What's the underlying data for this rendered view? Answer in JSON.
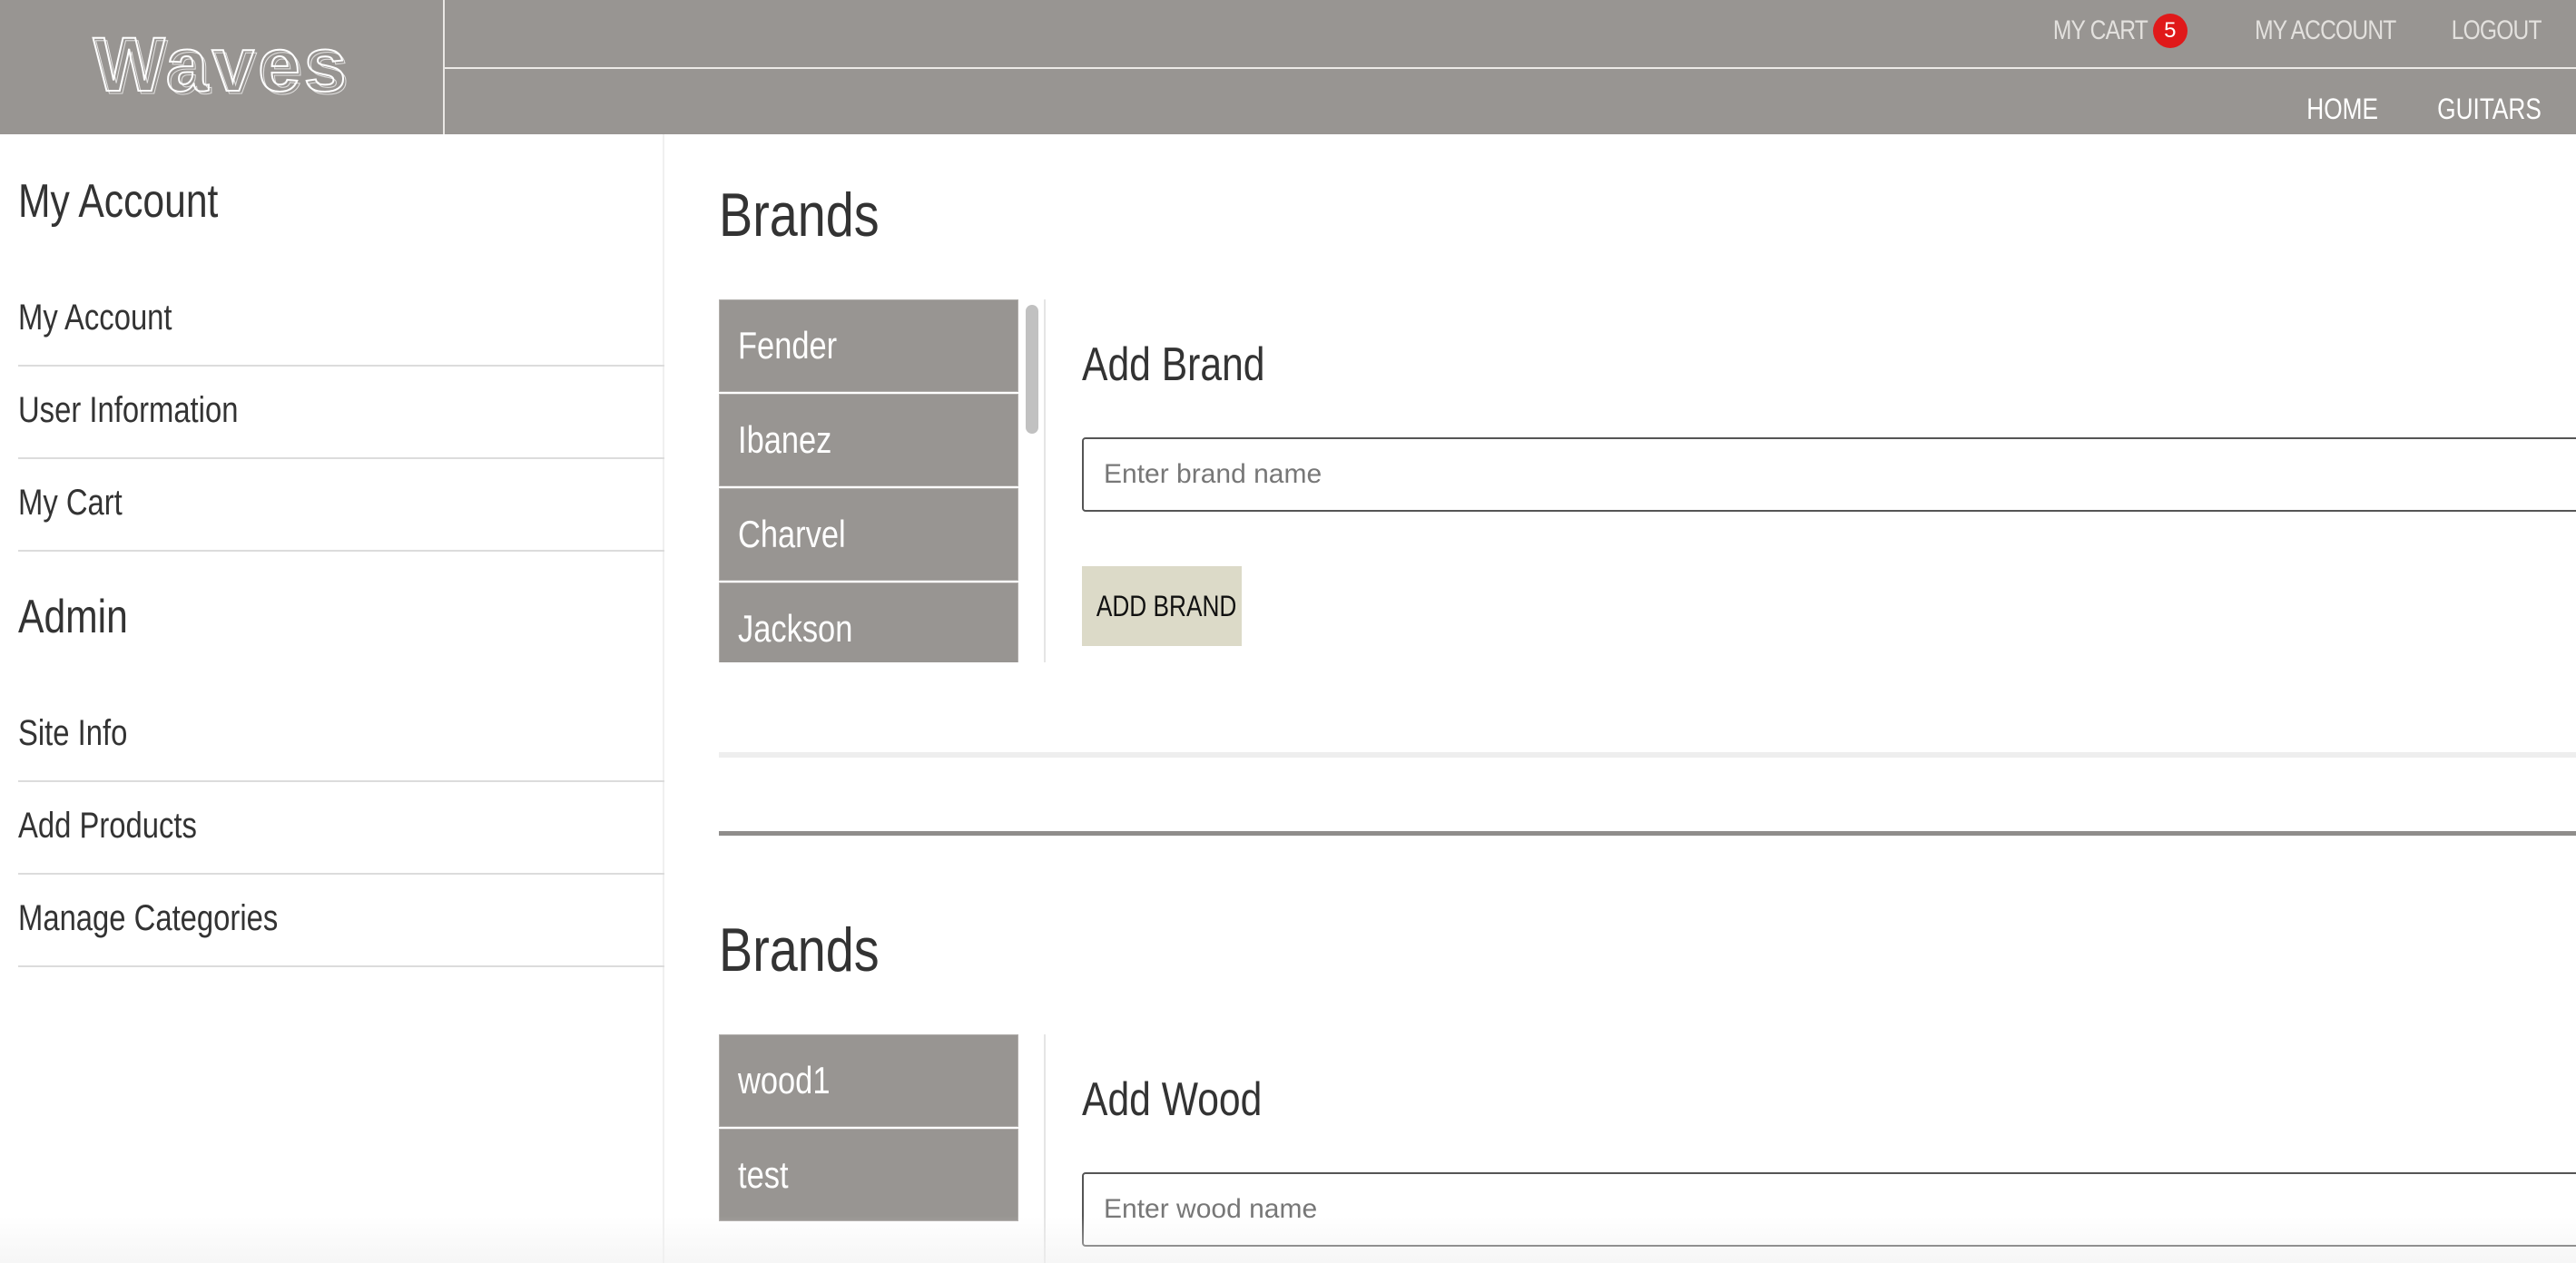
{
  "header": {
    "logo_text": "Waves",
    "top_links": {
      "cart": "MY CART",
      "cart_count": "5",
      "account": "MY ACCOUNT",
      "logout": "LOGOUT"
    },
    "main_links": {
      "home": "HOME",
      "guitars": "GUITARS"
    }
  },
  "sidebar": {
    "account_heading": "My Account",
    "account_items": [
      {
        "label": "My Account"
      },
      {
        "label": "User Information"
      },
      {
        "label": "My Cart"
      }
    ],
    "admin_heading": "Admin",
    "admin_items": [
      {
        "label": "Site Info"
      },
      {
        "label": "Add Products"
      },
      {
        "label": "Manage Categories"
      }
    ]
  },
  "brands_section": {
    "title": "Brands",
    "items": [
      "Fender",
      "Ibanez",
      "Charvel",
      "Jackson"
    ],
    "form_title": "Add Brand",
    "input_placeholder": "Enter brand name",
    "input_value": "",
    "button_label": "ADD BRAND"
  },
  "woods_section": {
    "title": "Brands",
    "items": [
      "wood1",
      "test"
    ],
    "form_title": "Add Wood",
    "input_placeholder": "Enter wood name",
    "input_value": ""
  }
}
